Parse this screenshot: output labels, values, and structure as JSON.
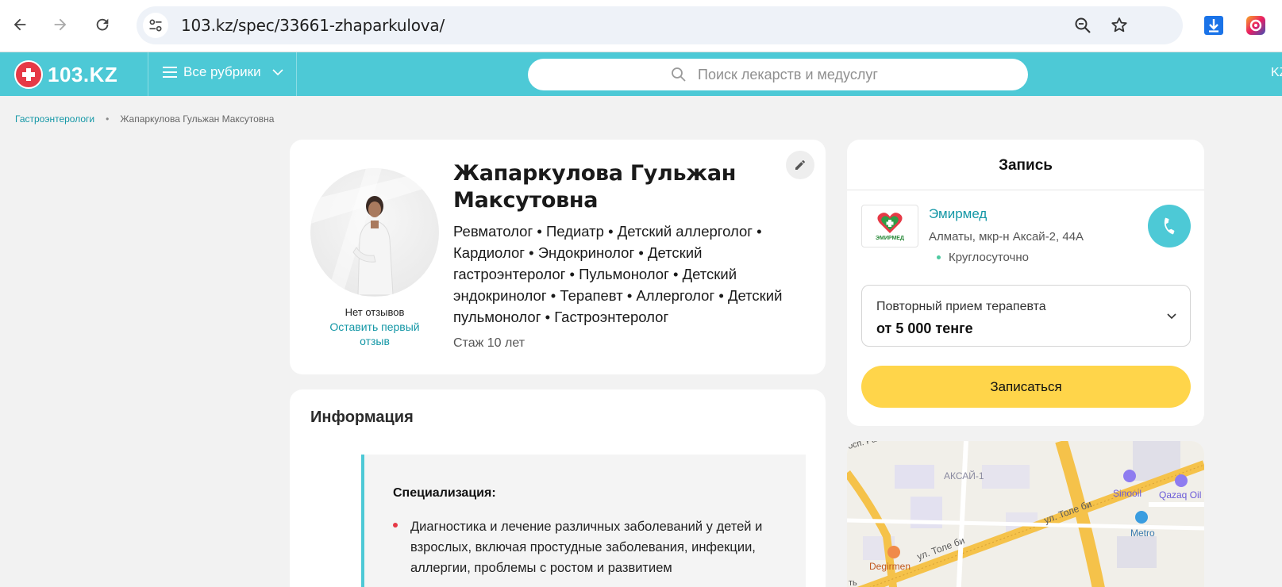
{
  "browser": {
    "url": "103.kz/spec/33661-zhaparkulova/"
  },
  "header": {
    "logo_text": "103.KZ",
    "rubrics_label": "Все рубрики",
    "search_placeholder": "Поиск лекарств и медуслуг",
    "lang": "KZ"
  },
  "breadcrumb": {
    "parent": "Гастроэнтерологи",
    "separator": "•",
    "current": "Жапаркулова Гульжан Максутовна"
  },
  "profile": {
    "name": "Жапаркулова Гульжан Максутовна",
    "specialties": "Ревматолог • Педиатр • Детский аллерголог • Кардиолог • Эндокринолог • Детский гастроэнтеролог • Пульмонолог • Детский эндокринолог • Терапевт • Аллерголог • Детский пульмонолог • Гастроэнтеролог",
    "experience": "Стаж 10 лет",
    "reviews_none": "Нет отзывов",
    "leave_review": "Оставить первый отзыв"
  },
  "info": {
    "title": "Информация",
    "spec_heading": "Специализация:",
    "spec_items": [
      "Диагностика и лечение различных заболеваний у детей и взрослых, включая простудные заболевания, инфекции, аллергии, проблемы с ростом и развитием"
    ]
  },
  "booking": {
    "title": "Запись",
    "clinic_name": "Эмирмед",
    "clinic_logo_text": "ЭМИРМЕД",
    "clinic_address": "Алматы, мкр-н Аксай-2, 44А",
    "clinic_hours": "Круглосуточно",
    "service_name": "Повторный прием терапевта",
    "service_price": "от 5 000 тенге",
    "book_button": "Записаться"
  },
  "map": {
    "labels": [
      "АКСАЙ-1",
      "ул. Толе би",
      "ул. Толе би",
      "Sinooil",
      "Qazaq Oil",
      "Metro",
      "Degirmen",
      "осп. Ра",
      "ть"
    ]
  },
  "colors": {
    "brand": "#4dc9d6",
    "logo_red": "#e63946",
    "link": "#1497a6",
    "book_button": "#ffd54a"
  }
}
